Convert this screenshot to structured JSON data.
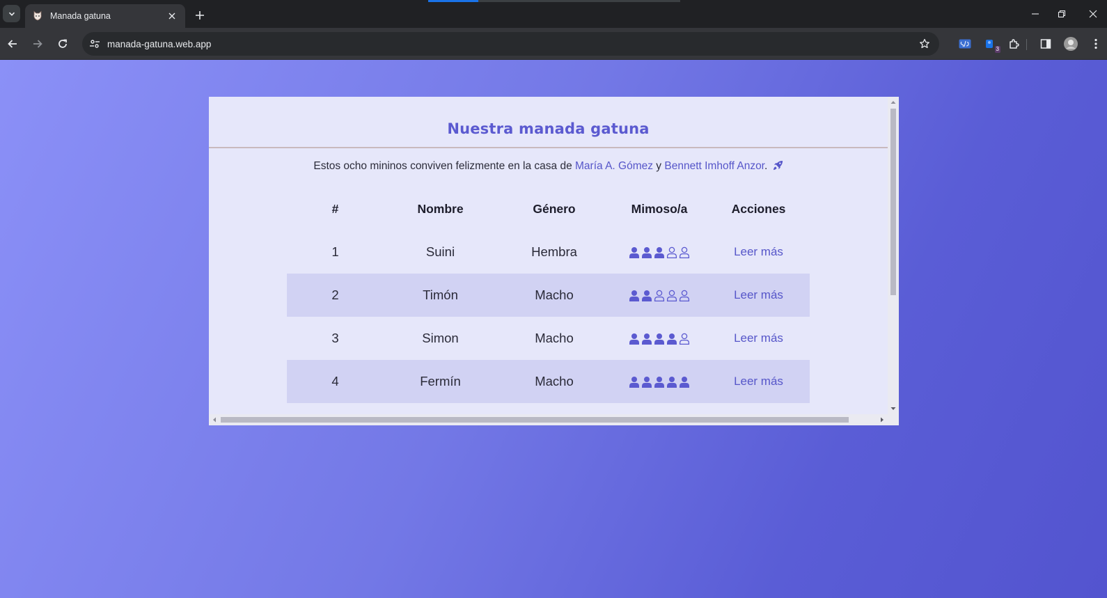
{
  "browser": {
    "tab_title": "Manada gatuna",
    "url": "manada-gatuna.web.app",
    "extension_badge": "3"
  },
  "page": {
    "title": "Nuestra manada gatuna",
    "intro_before": "Estos ocho mininos conviven felizmente en la casa de ",
    "author1": "María A. Gómez",
    "intro_middle": " y ",
    "author2": "Bennett Imhoff Anzor",
    "intro_after": "."
  },
  "table": {
    "headers": [
      "#",
      "Nombre",
      "Género",
      "Mimoso/a",
      "Acciones"
    ],
    "rows": [
      {
        "num": "1",
        "name": "Suini",
        "gender": "Hembra",
        "cuddly": 3,
        "action": "Leer más"
      },
      {
        "num": "2",
        "name": "Timón",
        "gender": "Macho",
        "cuddly": 2,
        "action": "Leer más"
      },
      {
        "num": "3",
        "name": "Simon",
        "gender": "Macho",
        "cuddly": 4,
        "action": "Leer más"
      },
      {
        "num": "4",
        "name": "Fermín",
        "gender": "Macho",
        "cuddly": 5,
        "action": "Leer más"
      }
    ],
    "cuddly_max": 5
  },
  "colors": {
    "accent": "#5b5ad0",
    "link": "#5656c9",
    "row_stripe": "#d1d2f3",
    "card_bg": "#e6e7fa"
  },
  "icons": {
    "cuddly_full": "user-solid-icon",
    "cuddly_empty": "user-outline-icon",
    "intro_trailing": "rocket-icon"
  }
}
